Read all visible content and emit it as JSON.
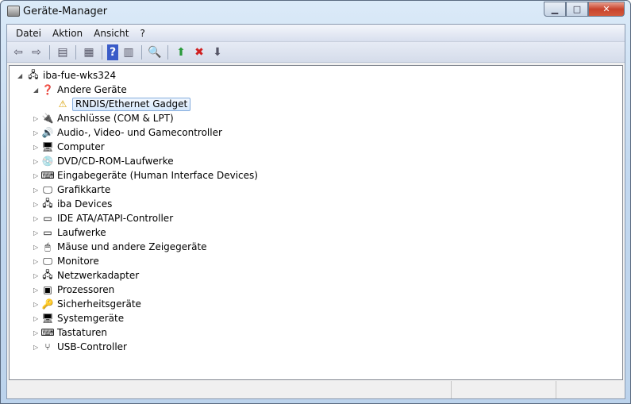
{
  "window": {
    "title": "Geräte-Manager"
  },
  "menu": [
    "Datei",
    "Aktion",
    "Ansicht",
    "?"
  ],
  "toolbar": [
    "back-icon",
    "forward-icon",
    "show-hide-console-tree-icon",
    "properties-icon",
    "help-icon",
    "show-action-pane-icon",
    "scan-hardware-icon",
    "update-driver-icon",
    "uninstall-icon",
    "disable-icon"
  ],
  "tree": {
    "root": "iba-fue-wks324",
    "expanded": {
      "label": "Andere Geräte",
      "children": [
        "RNDIS/Ethernet Gadget"
      ]
    },
    "categories": [
      "Anschlüsse (COM & LPT)",
      "Audio-, Video- und Gamecontroller",
      "Computer",
      "DVD/CD-ROM-Laufwerke",
      "Eingabegeräte (Human Interface Devices)",
      "Grafikkarte",
      "iba Devices",
      "IDE ATA/ATAPI-Controller",
      "Laufwerke",
      "Mäuse und andere Zeigegeräte",
      "Monitore",
      "Netzwerkadapter",
      "Prozessoren",
      "Sicherheitsgeräte",
      "Systemgeräte",
      "Tastaturen",
      "USB-Controller"
    ]
  }
}
